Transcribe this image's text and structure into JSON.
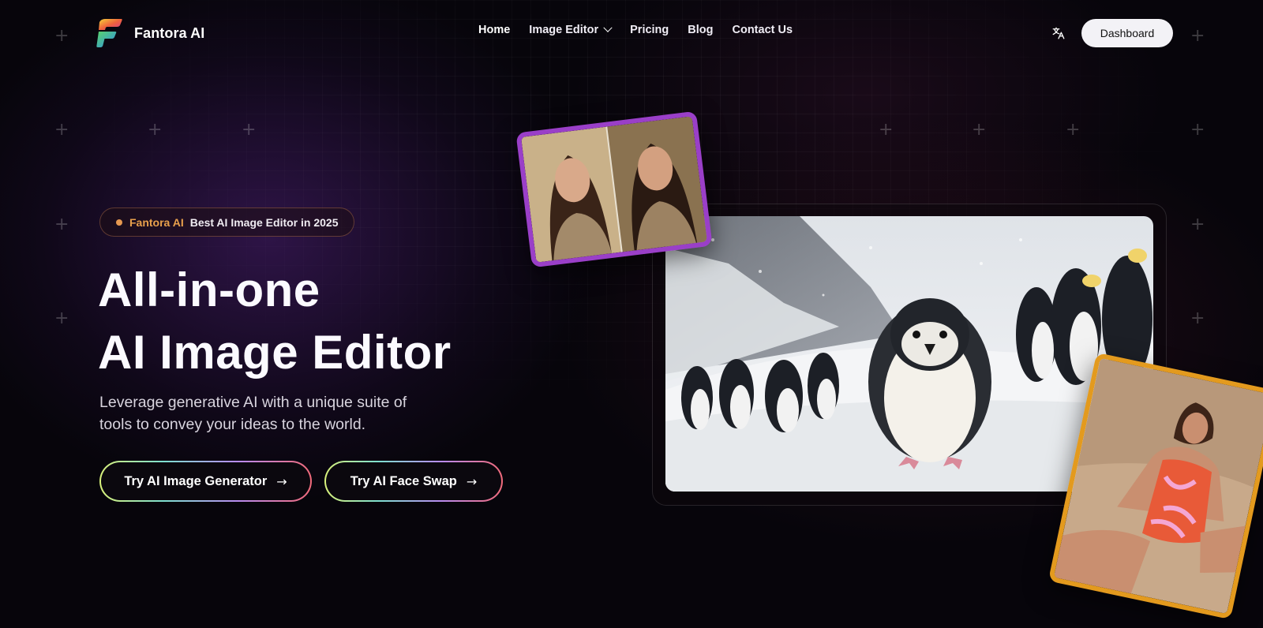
{
  "header": {
    "brand_name": "Fantora AI",
    "nav": [
      {
        "label": "Home",
        "active": true
      },
      {
        "label": "Image Editor",
        "has_dropdown": true
      },
      {
        "label": "Pricing"
      },
      {
        "label": "Blog"
      },
      {
        "label": "Contact Us"
      }
    ],
    "language_icon": "translate-icon",
    "dashboard_label": "Dashboard"
  },
  "hero": {
    "badge": {
      "brand": "Fantora AI",
      "text": "Best AI Image Editor in 2025"
    },
    "title_line1": "All-in-one",
    "title_line2": "AI Image Editor",
    "subtitle": "Leverage generative AI with a unique suite of tools to convey your ideas to the world.",
    "cta_primary": "Try AI Image Generator",
    "cta_secondary": "Try AI Face Swap",
    "arrow_glyph": "→"
  },
  "visuals": {
    "main_image": "penguins-in-snow-photo",
    "before_after_image": "woman-portrait-before-after-photo",
    "swimsuit_image": "woman-in-swimsuit-on-beach-photo"
  },
  "colors": {
    "background": "#07050b",
    "badge_accent": "#e8a04c",
    "before_after_border": "#9a3fc8",
    "swimsuit_border": "#e39a1e",
    "dashboard_button": "#f3f2f6"
  }
}
